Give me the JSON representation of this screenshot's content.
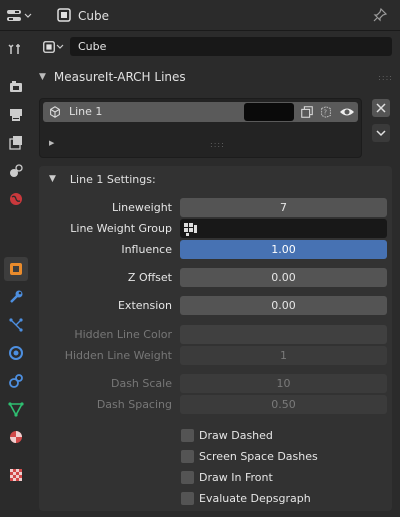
{
  "header": {
    "object_name": "Cube"
  },
  "context": {
    "object_name": "Cube"
  },
  "panel": {
    "title": "MeasureIt-ARCH Lines"
  },
  "list": {
    "item_name": "Line 1",
    "item_color": "#0a0a0a"
  },
  "settings": {
    "title": "Line 1 Settings:",
    "lineweight_label": "Lineweight",
    "lineweight_value": "7",
    "weight_group_label": "Line Weight Group",
    "influence_label": "Influence",
    "influence_value": "1.00",
    "zoffset_label": "Z Offset",
    "zoffset_value": "0.00",
    "extension_label": "Extension",
    "extension_value": "0.00",
    "hidden_color_label": "Hidden Line Color",
    "hidden_weight_label": "Hidden Line Weight",
    "hidden_weight_value": "1",
    "dash_scale_label": "Dash Scale",
    "dash_scale_value": "10",
    "dash_spacing_label": "Dash Spacing",
    "dash_spacing_value": "0.50"
  },
  "checkboxes": [
    "Draw Dashed",
    "Screen Space Dashes",
    "Draw In Front",
    "Evaluate Depsgraph"
  ],
  "colors": {
    "accent_blue": "#4772b3",
    "panel_bg": "#2b2b2b",
    "field_bg": "#545454"
  }
}
